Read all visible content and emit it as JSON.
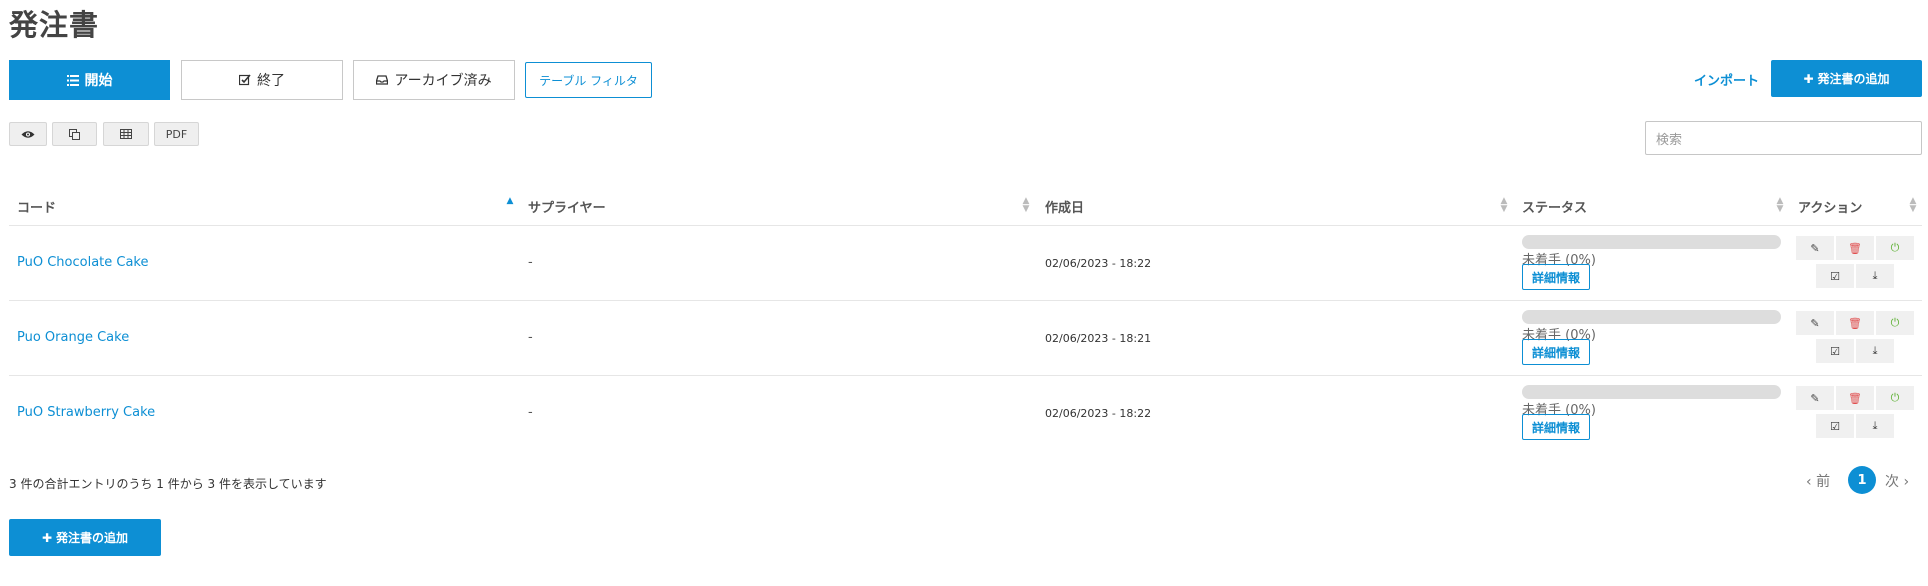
{
  "page": {
    "title": "発注書"
  },
  "tabs": [
    {
      "label": "開始",
      "icon": "list-icon",
      "active": true
    },
    {
      "label": "終了",
      "icon": "check-square-icon",
      "active": false
    },
    {
      "label": "アーカイブ済み",
      "icon": "inbox-icon",
      "active": false
    }
  ],
  "filter_label": "テーブル フィルタ",
  "import_label": "インポート",
  "add_label": "発注書の追加",
  "tools": {
    "pdf": "PDF",
    "icons": [
      "eye-icon",
      "copy-icon",
      "table-icon"
    ]
  },
  "search": {
    "placeholder": "検索"
  },
  "table": {
    "columns": [
      "コード",
      "サプライヤー",
      "作成日",
      "ステータス",
      "アクション"
    ],
    "sorted_column": "コード",
    "rows": [
      {
        "code": "PuO Chocolate Cake",
        "supplier": "-",
        "date": "02/06/2023 - 18:22",
        "status": "未着手",
        "progress": "(0%)",
        "detail": "詳細情報"
      },
      {
        "code": "Puo Orange Cake",
        "supplier": "-",
        "date": "02/06/2023 - 18:21",
        "status": "未着手",
        "progress": "(0%)",
        "detail": "詳細情報"
      },
      {
        "code": "PuO Strawberry Cake",
        "supplier": "-",
        "date": "02/06/2023 - 18:22",
        "status": "未着手",
        "progress": "(0%)",
        "detail": "詳細情報"
      }
    ]
  },
  "footer": {
    "info": "3 件の合計エントリのうち 1 件から 3 件を表示しています",
    "prev": "前",
    "page": "1",
    "next": "次"
  },
  "colors": {
    "accent": "#0d8fd4",
    "danger": "#e05050",
    "success": "#5bb030"
  }
}
